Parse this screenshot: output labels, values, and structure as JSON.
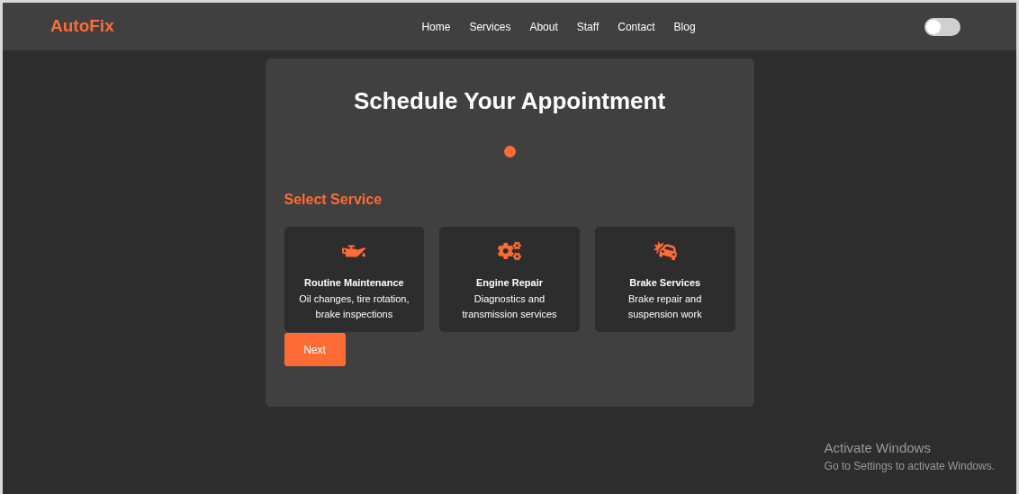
{
  "navbar": {
    "brand": "AutoFix",
    "links": [
      "Home",
      "Services",
      "About",
      "Staff",
      "Contact",
      "Blog"
    ],
    "theme_toggle": {
      "on": false
    }
  },
  "form": {
    "title": "Schedule Your Appointment",
    "steps": [
      {
        "selected": true
      }
    ],
    "section_title": "Select Service",
    "services": [
      {
        "kind": "oil",
        "name": "Routine Maintenance",
        "description": "Oil changes, tire rotation, brake inspections"
      },
      {
        "kind": "gears",
        "name": "Engine Repair",
        "description": "Diagnostics and transmission services"
      },
      {
        "kind": "crash",
        "name": "Brake Services",
        "description": "Brake repair and suspension work"
      }
    ],
    "next_button": "Next"
  },
  "os_notice": {
    "title": "Activate Windows",
    "subtitle": "Go to Settings to activate Windows."
  }
}
